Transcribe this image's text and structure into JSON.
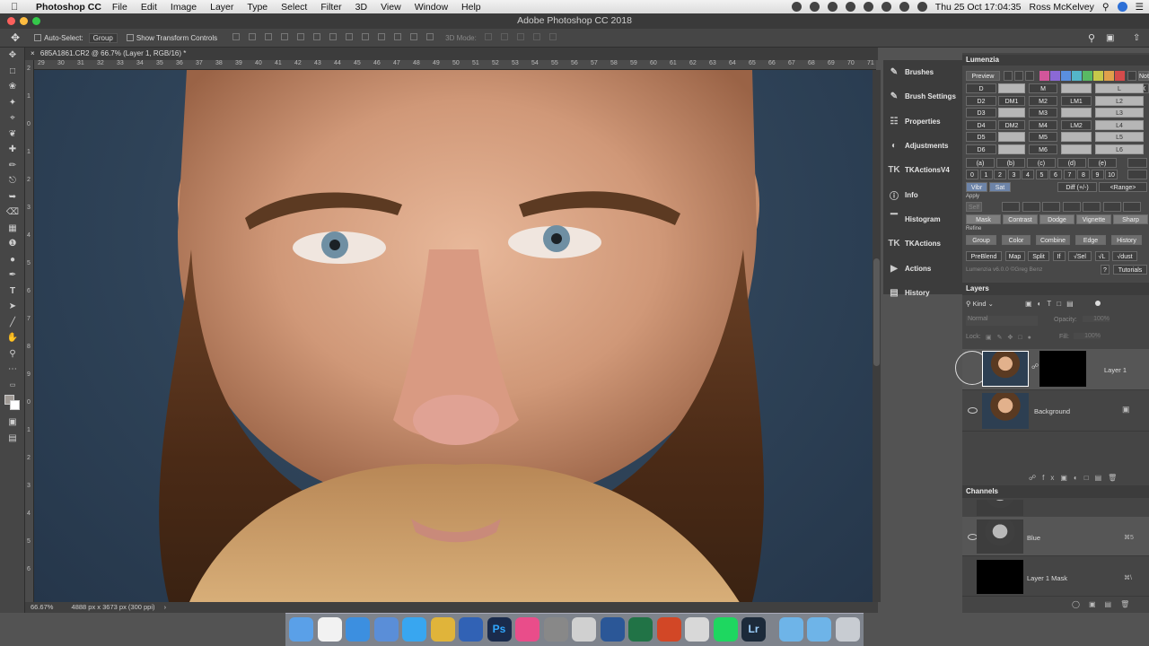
{
  "menubar": {
    "app": "Photoshop CC",
    "items": [
      "File",
      "Edit",
      "Image",
      "Layer",
      "Type",
      "Select",
      "Filter",
      "3D",
      "View",
      "Window",
      "Help"
    ],
    "clock": "Thu 25 Oct  17:04:35",
    "user": "Ross McKelvey"
  },
  "window": {
    "title": "Adobe Photoshop CC 2018"
  },
  "options": {
    "auto_select": "Auto-Select:",
    "auto_select_value": "Group",
    "transform": "Show Transform Controls",
    "mode_3d": "3D Mode:"
  },
  "doc": {
    "tab": "685A1861.CR2 @ 66.7% (Layer 1, RGB/16) *",
    "zoom": "66.67%",
    "size": "4888 px x 3673 px (300 ppi)"
  },
  "ruler": {
    "h": [
      "29",
      "30",
      "31",
      "32",
      "33",
      "34",
      "35",
      "36",
      "37",
      "38",
      "39",
      "40",
      "41",
      "42",
      "43",
      "44",
      "45",
      "46",
      "47",
      "48",
      "49",
      "50",
      "51",
      "52",
      "53",
      "54",
      "55",
      "56",
      "57",
      "58",
      "59",
      "60",
      "61",
      "62",
      "63",
      "64",
      "65",
      "66",
      "67",
      "68",
      "69",
      "70",
      "71"
    ],
    "v": [
      "2",
      "1",
      "0",
      "1",
      "2",
      "3",
      "4",
      "5",
      "6",
      "7",
      "8",
      "9",
      "0",
      "1",
      "2",
      "3",
      "4",
      "5",
      "6"
    ]
  },
  "dock_panels": [
    "Brushes",
    "Brush Settings",
    "Properties",
    "Adjustments",
    "TKActionsV4",
    "Info",
    "Histogram",
    "TKActions",
    "Actions",
    "History"
  ],
  "lumenzia": {
    "title": "Lumenzia",
    "preview": "Preview",
    "not": "Not",
    "x": "X",
    "rows": [
      [
        "D",
        "",
        "M",
        "",
        "L"
      ],
      [
        "D2",
        "DM1",
        "M2",
        "LM1",
        "L2"
      ],
      [
        "D3",
        "",
        "M3",
        "",
        "L3"
      ],
      [
        "D4",
        "DM2",
        "M4",
        "LM2",
        "L4"
      ],
      [
        "D5",
        "",
        "M5",
        "",
        "L5"
      ],
      [
        "D6",
        "",
        "M6",
        "",
        "L6"
      ]
    ],
    "paren": [
      "(a)",
      "(b)",
      "(c)",
      "(d)",
      "(e)"
    ],
    "nums": [
      "0",
      "1",
      "2",
      "3",
      "4",
      "5",
      "6",
      "7",
      "8",
      "9",
      "10"
    ],
    "vibr": "Vibr",
    "sat": "Sat",
    "diff": "Diff (+/-)",
    "range": "<Range>",
    "apply": "Apply",
    "self": "Self",
    "apply_row": [
      "Mask",
      "Contrast",
      "Dodge",
      "Vignette",
      "Sharp"
    ],
    "refine": "Refine",
    "refine_row": [
      "Group",
      "Color",
      "Combine",
      "Edge",
      "History"
    ],
    "action_row": [
      "PreBlend",
      "Map",
      "Split",
      "If",
      "√Sel",
      "√L",
      "√dust"
    ],
    "version": "Lumenzia v6.0.0 ©Greg Benz",
    "help": "?",
    "tutorials": "Tutorials"
  },
  "layers": {
    "title": "Layers",
    "kind": "Kind",
    "blend": "Normal",
    "opacity": "Opacity:",
    "opacity_val": "100%",
    "lock": "Lock:",
    "fill": "Fill:",
    "fill_val": "100%",
    "items": [
      {
        "name": "Layer 1"
      },
      {
        "name": "Background"
      }
    ]
  },
  "channels": {
    "title": "Channels",
    "items": [
      {
        "name": "Blue",
        "shortcut": "⌘5"
      },
      {
        "name": "Layer 1 Mask",
        "shortcut": "⌘\\"
      }
    ]
  },
  "colors": {
    "accent": "#2c6fd6"
  }
}
